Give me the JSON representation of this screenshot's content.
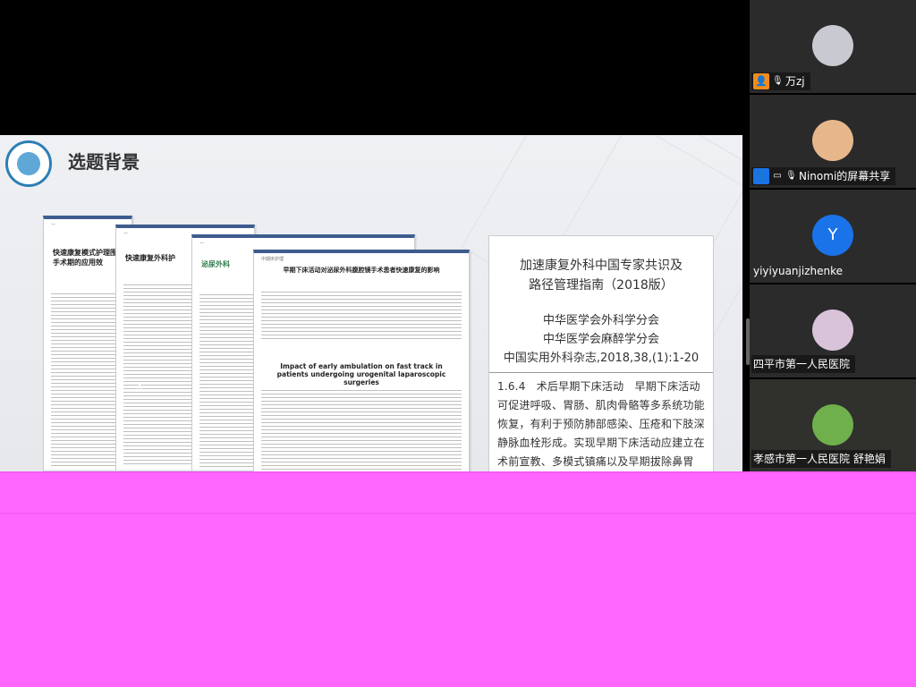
{
  "slide": {
    "title": "选题背景",
    "doc1": {
      "title": "快速康复模式护理围手术期的应用效"
    },
    "doc2": {
      "title": "快速康复外科护"
    },
    "doc3": {
      "title": "泌尿外科"
    },
    "doc4": {
      "section": "中期床护理",
      "title": "早期下床活动对泌尿外科腹腔镜手术患者快速康复的影响",
      "en_title": "Impact of early ambulation on fast track in patients undergoing urogenital laparoscopic surgeries"
    },
    "guide": {
      "title_line1": "加速康复外科中国专家共识及",
      "title_line2": "路径管理指南（2018版）",
      "org_line1": "中华医学会外科学分会",
      "org_line2": "中华医学会麻醉学分会",
      "citation": "中国实用外科杂志,2018,38,(1):1-20",
      "body": "1.6.4　术后早期下床活动　早期下床活动可促进呼吸、胃肠、肌肉骨骼等多系统功能恢复，有利于预防肺部感染、压疮和下肢深静脉血栓形成。实现早期下床活动应建立在术前宣教、多模式镇痛以及早期拔除鼻胃管、尿管和腹腔引流管等各"
    }
  },
  "participants": [
    {
      "name": "万zj",
      "avatar_color": "#c9c9d2",
      "initial": "",
      "icon": "person-icon"
    },
    {
      "name": "Ninomi的屏幕共享",
      "avatar_color": "#e7b78c",
      "initial": "",
      "icon": "screen-share-icon"
    },
    {
      "name": "yiyiyuanjizhenke",
      "avatar_color": "#1a73e8",
      "initial": "Y",
      "icon": ""
    },
    {
      "name": "四平市第一人民医院",
      "avatar_color": "#d8c3d9",
      "initial": "",
      "icon": ""
    },
    {
      "name": "孝感市第一人民医院 舒艳娟",
      "avatar_color": "#6fb04c",
      "initial": "",
      "icon": ""
    }
  ]
}
